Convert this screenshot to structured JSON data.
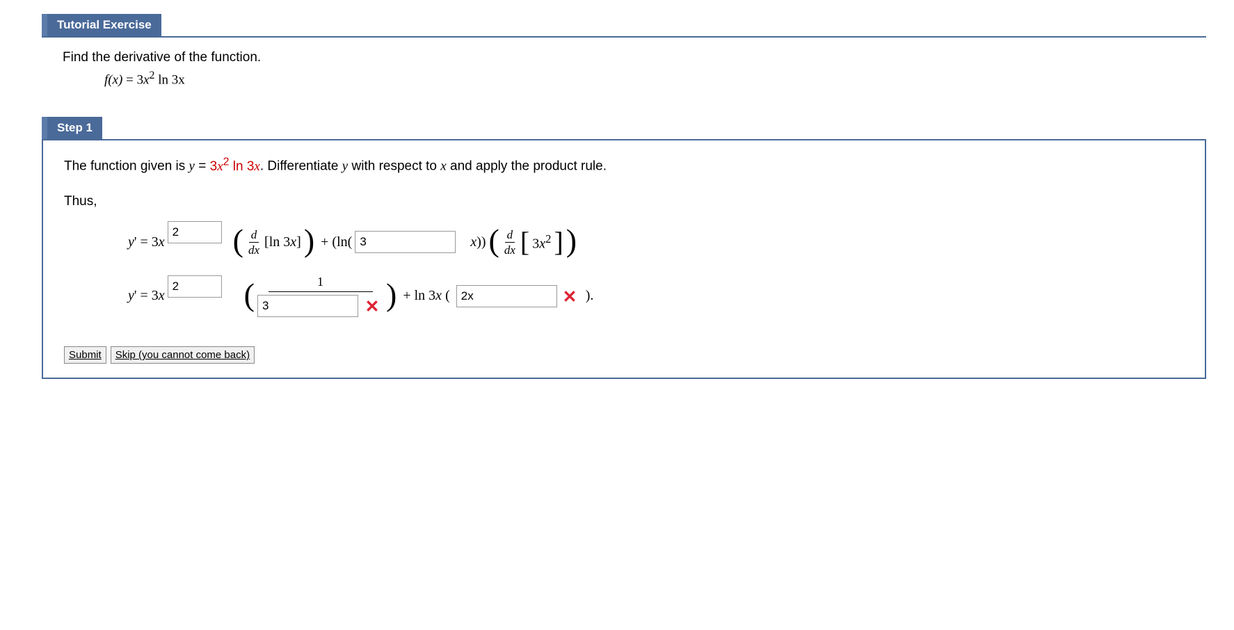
{
  "header_tutorial": "Tutorial Exercise",
  "prompt": "Find the derivative of the function.",
  "func_lhs": "f(x)",
  "func_eq": " = ",
  "func_coef": "3",
  "func_var": "x",
  "func_exp": "2",
  "func_ln": " ln ",
  "func_arg": "3x",
  "header_step": "Step 1",
  "step_text_a": "The function given is  ",
  "step_text_y": "y",
  "step_text_eq": " = ",
  "step_text_rhs_coef": "3",
  "step_text_rhs_var": "x",
  "step_text_rhs_exp": "2",
  "step_text_rhs_ln": " ln ",
  "step_text_rhs_arg": "3x",
  "step_text_b": ".  Differentiate ",
  "step_text_c": " with respect to ",
  "step_text_x": "x",
  "step_text_d": " and apply the product rule.",
  "thus": "Thus,",
  "row1": {
    "lhs": "y' = 3x",
    "input1": "2",
    "d": "d",
    "dx": "dx",
    "ln3x": "[ln 3x]",
    "plus": " + (ln(",
    "input2": "3",
    "xclose": "x))",
    "inner": "3x",
    "inner_exp": "2"
  },
  "row2": {
    "lhs": "y' = 3x",
    "input1": "2",
    "one": "1",
    "input2": "3",
    "plus_ln": " + ln 3x (",
    "input3": "2x",
    "close": " )."
  },
  "btn_submit": "Submit",
  "btn_skip": "Skip (you cannot come back)"
}
